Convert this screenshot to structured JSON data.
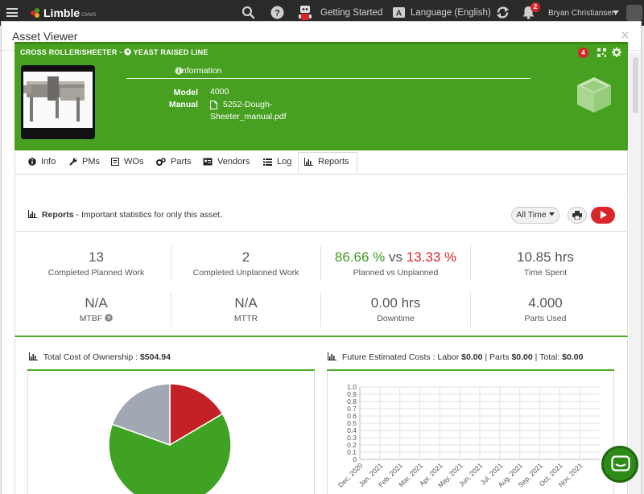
{
  "nav": {
    "logo": "Limble",
    "logo_sub": "CMMS",
    "getting_started": "Getting Started",
    "language": "Language (English)",
    "notifications_count": "2",
    "user_name": "Bryan Christiansen"
  },
  "modal": {
    "title": "Asset Viewer",
    "close": "×"
  },
  "asset": {
    "name": "CROSS ROLLER/SHEETER",
    "separator": "-",
    "location": "YEAST RAISED LINE",
    "badge_count": "4",
    "info_label": "Information",
    "model_label": "Model",
    "model_value": "4000",
    "manual_label": "Manual",
    "manual_line1": "5252-Dough-",
    "manual_line2": "Sheeter_manual.pdf"
  },
  "tabs": [
    {
      "label": "Info"
    },
    {
      "label": "PMs"
    },
    {
      "label": "WOs"
    },
    {
      "label": "Parts"
    },
    {
      "label": "Vendors"
    },
    {
      "label": "Log"
    },
    {
      "label": "Reports"
    }
  ],
  "reports": {
    "title": "Reports",
    "subtitle": "- Important statistics for only this asset.",
    "filter": "All Time"
  },
  "stats": {
    "completed_planned": {
      "value": "13",
      "label": "Completed Planned Work"
    },
    "completed_unplanned": {
      "value": "2",
      "label": "Completed Unplanned Work"
    },
    "planned_vs_unplanned": {
      "planned": "86.66 %",
      "vs": "vs",
      "unplanned": "13.33 %",
      "label": "Planned vs Unplanned"
    },
    "time_spent": {
      "value": "10.85 hrs",
      "label": "Time Spent"
    },
    "mtbf": {
      "value": "N/A",
      "label": "MTBF"
    },
    "mttr": {
      "value": "N/A",
      "label": "MTTR"
    },
    "downtime": {
      "value": "0.00 hrs",
      "label": "Downtime"
    },
    "parts_used": {
      "value": "4.000",
      "label": "Parts Used"
    }
  },
  "tco": {
    "title": "Total Cost of Ownership :",
    "amount": "$504.94"
  },
  "future": {
    "title": "Future Estimated Costs : Labor",
    "labor": "$0.00",
    "parts_label": "| Parts",
    "parts": "$0.00",
    "total_label": "| Total:",
    "total": "$0.00"
  },
  "colors": {
    "green": "#47a01f",
    "red": "#d9262b",
    "gray": "#a0a8b3"
  },
  "chart_data": [
    {
      "type": "pie",
      "slices": [
        {
          "color": "#c42127",
          "value": 16.5
        },
        {
          "color": "#3fa223",
          "value": 64
        },
        {
          "color": "#a0a8b3",
          "value": 19.5
        }
      ]
    },
    {
      "type": "line",
      "categories": [
        "Dec, 2020",
        "Jan, 2021",
        "Feb, 2021",
        "Mar, 2021",
        "Apr, 2021",
        "May, 2021",
        "Jun, 2021",
        "Jul, 2021",
        "Aug, 2021",
        "Sep, 2021",
        "Oct, 2021",
        "Nov, 2021"
      ],
      "y_ticks": [
        "0",
        "0.1",
        "0.2",
        "0.3",
        "0.4",
        "0.5",
        "0.6",
        "0.7",
        "0.8",
        "0.9",
        "1.0"
      ],
      "ylim": [
        0,
        1
      ],
      "series": [],
      "grid": true
    }
  ]
}
